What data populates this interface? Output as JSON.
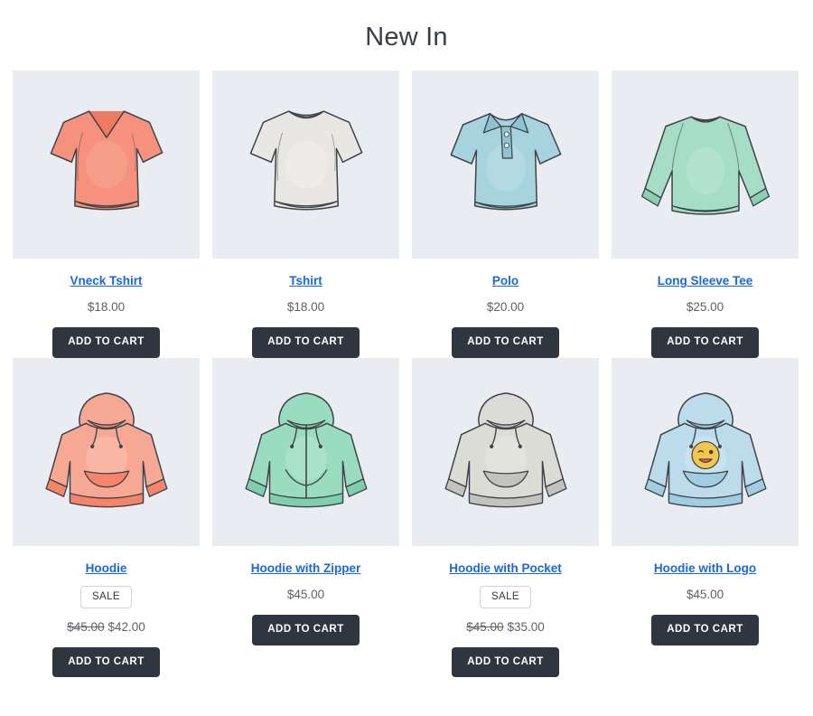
{
  "header": {
    "title": "New In"
  },
  "labels": {
    "add_to_cart": "ADD TO CART",
    "sale_badge": "SALE"
  },
  "colors": {
    "tile_background": "#e9edf1",
    "link": "#1769e0",
    "button_background": "#2f3640",
    "button_text": "#ffffff",
    "price_text": "#5c6268",
    "title_text": "#3a3f45",
    "badge_border": "#cfd4d9"
  },
  "products": [
    {
      "name": "Vneck Tshirt",
      "price": "$18.00",
      "on_sale": false,
      "regular_price": null,
      "sale_price": null,
      "icon": "vneck-tshirt-illustration",
      "garment": "vneck",
      "color": "#f5917c",
      "shade": "#ef7a62",
      "highlight": "#f8aa97"
    },
    {
      "name": "Tshirt",
      "price": "$18.00",
      "on_sale": false,
      "regular_price": null,
      "sale_price": null,
      "icon": "tshirt-illustration",
      "garment": "tshirt",
      "color": "#e8e7e3",
      "shade": "#d6d5d0",
      "highlight": "#f2f1ee"
    },
    {
      "name": "Polo",
      "price": "$20.00",
      "on_sale": false,
      "regular_price": null,
      "sale_price": null,
      "icon": "polo-shirt-illustration",
      "garment": "polo",
      "color": "#a7d3de",
      "shade": "#8ec3d2",
      "highlight": "#bfe0e8"
    },
    {
      "name": "Long Sleeve Tee",
      "price": "$25.00",
      "on_sale": false,
      "regular_price": null,
      "sale_price": null,
      "icon": "long-sleeve-tee-illustration",
      "garment": "longsleeve",
      "color": "#a5ddc6",
      "shade": "#8ccfb4",
      "highlight": "#bfe8d6"
    },
    {
      "name": "Hoodie",
      "price": null,
      "on_sale": true,
      "regular_price": "$45.00",
      "sale_price": "$42.00",
      "icon": "hoodie-illustration",
      "garment": "hoodie",
      "color": "#f7a894",
      "shade": "#f5846a",
      "highlight": "#fbc3b4"
    },
    {
      "name": "Hoodie with Zipper",
      "price": "$45.00",
      "on_sale": false,
      "regular_price": null,
      "sale_price": null,
      "icon": "hoodie-with-zipper-illustration",
      "garment": "zipper",
      "color": "#9adcc0",
      "shade": "#7fcfae",
      "highlight": "#b8e8d2"
    },
    {
      "name": "Hoodie with Pocket",
      "price": null,
      "on_sale": true,
      "regular_price": "$45.00",
      "sale_price": "$35.00",
      "icon": "hoodie-with-pocket-illustration",
      "garment": "hoodie",
      "color": "#dcdcd7",
      "shade": "#c3c3bd",
      "highlight": "#e9e9e5"
    },
    {
      "name": "Hoodie with Logo",
      "price": "$45.00",
      "on_sale": false,
      "regular_price": null,
      "sale_price": null,
      "icon": "hoodie-with-logo-illustration",
      "garment": "logo",
      "color": "#bcdcec",
      "shade": "#a0cde2",
      "highlight": "#d3e9f4"
    }
  ]
}
